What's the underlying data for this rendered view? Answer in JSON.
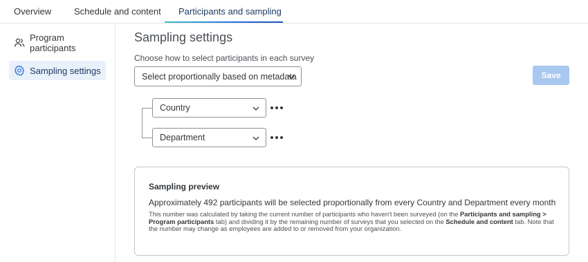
{
  "tabs": [
    {
      "label": "Overview",
      "active": false
    },
    {
      "label": "Schedule and content",
      "active": false
    },
    {
      "label": "Participants and sampling",
      "active": true
    }
  ],
  "sidebar": {
    "items": [
      {
        "label": "Program participants",
        "icon": "people-icon",
        "active": false
      },
      {
        "label": "Sampling settings",
        "icon": "gear-icon",
        "active": true
      }
    ]
  },
  "main": {
    "title": "Sampling settings",
    "select_label": "Choose how to select participants in each survey",
    "select_value": "Select proportionally based on metadata",
    "save_label": "Save",
    "fields": [
      {
        "value": "Country"
      },
      {
        "value": "Department"
      }
    ]
  },
  "preview": {
    "title": "Sampling preview",
    "summary": "Approximately 492 participants will be selected proportionally from every Country and Department every month",
    "note_1": "This number was calculated by taking the current number of participants who haven't been surveyed (on the ",
    "note_bold_1": "Participants and sampling > Program participants",
    "note_2": " tab) and dividing it by the remaining number of surveys that you selected on the ",
    "note_bold_2": "Schedule and content",
    "note_3": " tab. Note that the number may change as employees are added to or removed from your organization."
  },
  "colors": {
    "accent": "#2b6fdb",
    "save_disabled": "#a9c8ef",
    "sidebar_active": "#e9f1fb"
  }
}
